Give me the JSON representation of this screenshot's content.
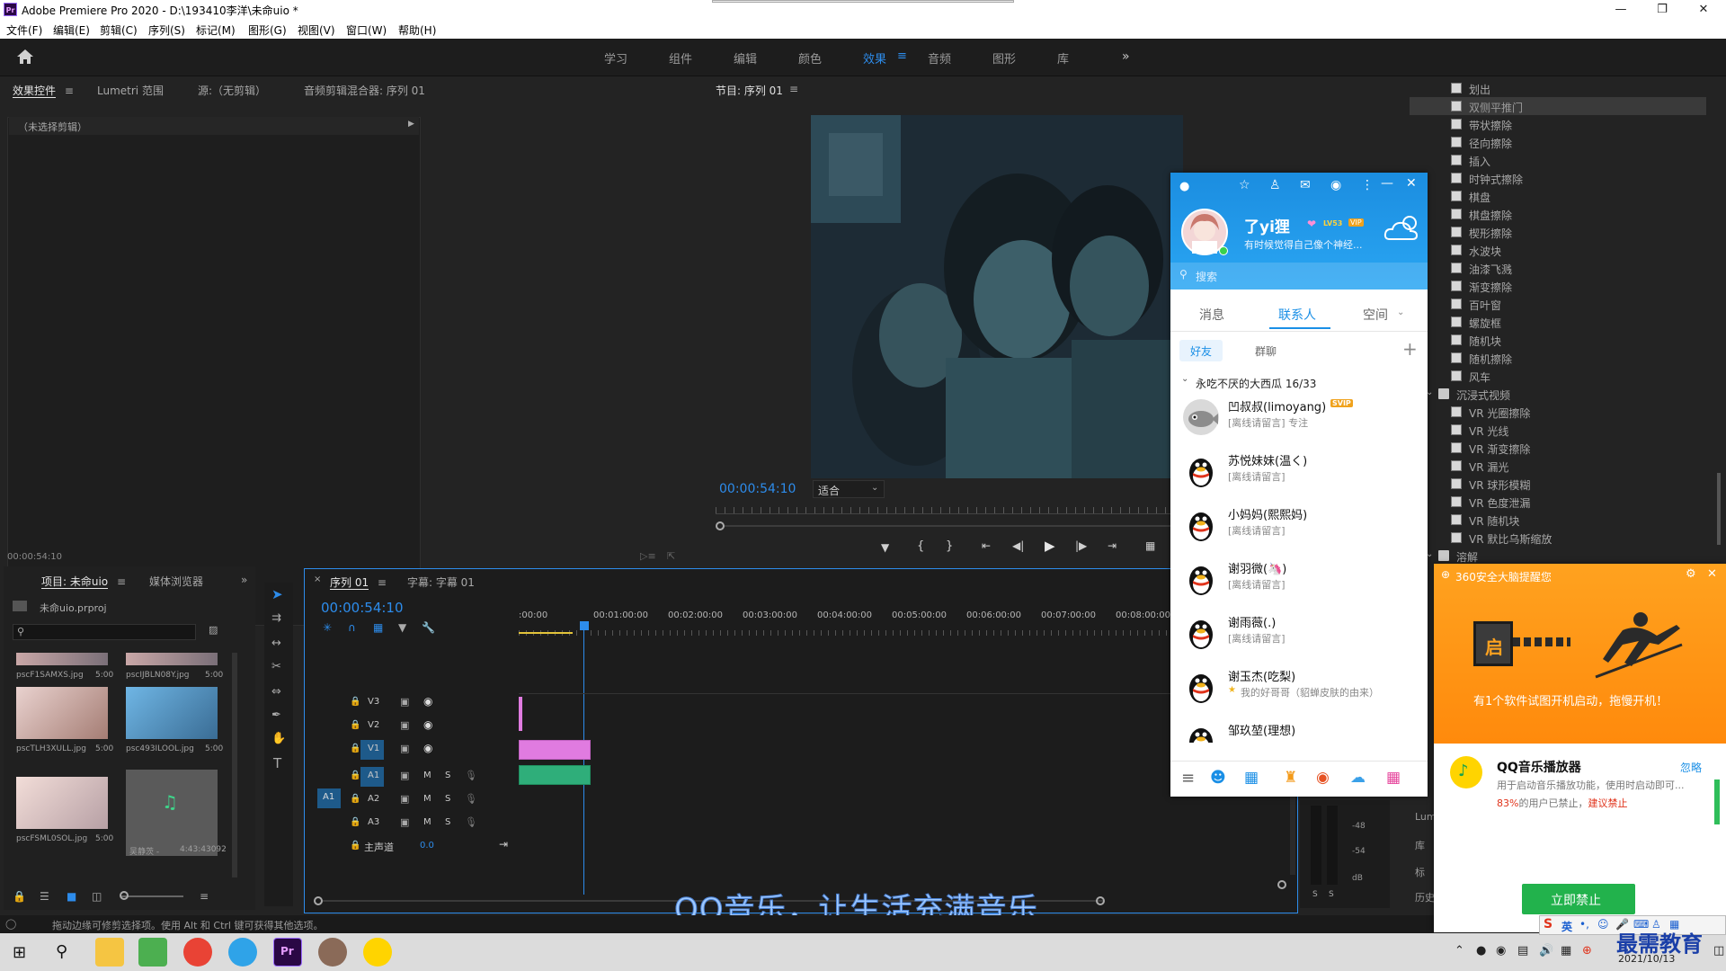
{
  "window": {
    "title": "Adobe Premiere Pro 2020 - D:\\193410李洋\\未命uio *",
    "app_icon": "Pr"
  },
  "menu": [
    "文件(F)",
    "编辑(E)",
    "剪辑(C)",
    "序列(S)",
    "标记(M)",
    "图形(G)",
    "视图(V)",
    "窗口(W)",
    "帮助(H)"
  ],
  "workspaces": [
    "学习",
    "组件",
    "编辑",
    "颜色",
    "效果",
    "音频",
    "图形",
    "库"
  ],
  "workspace_active": "效果",
  "effect_controls": {
    "tabs": [
      "效果控件",
      "Lumetri 范围",
      "源:（无剪辑）",
      "音频剪辑混合器: 序列 01"
    ],
    "empty_label": "（未选择剪辑）",
    "timecode": "00:00:54:10"
  },
  "program_monitor": {
    "title": "节目: 序列 01",
    "timecode": "00:00:54:10",
    "fit": "适合"
  },
  "effects_list": {
    "items": [
      "划出",
      "双侧平推门",
      "带状擦除",
      "径向擦除",
      "插入",
      "时钟式擦除",
      "棋盘",
      "棋盘擦除",
      "楔形擦除",
      "水波块",
      "油漆飞溅",
      "渐变擦除",
      "百叶窗",
      "螺旋框",
      "随机块",
      "随机擦除",
      "风车"
    ],
    "folder_1": "沉浸式视频",
    "vr_items": [
      "VR 光圈擦除",
      "VR 光线",
      "VR 渐变擦除",
      "VR 漏光",
      "VR 球形模糊",
      "VR 色度泄漏",
      "VR 随机块",
      "VR 默比乌斯缩放"
    ],
    "folder_2": "溶解",
    "selected": "双侧平推门"
  },
  "project": {
    "tabs": [
      "项目: 未命uio",
      "媒体浏览器"
    ],
    "file": "未命uio.prproj",
    "thumbs": [
      {
        "name": "pscF1SAMXS.jpg",
        "dur": "5:00"
      },
      {
        "name": "pscIJBLN08Y.jpg",
        "dur": "5:00"
      },
      {
        "name": "pscTLH3XULL.jpg",
        "dur": "5:00"
      },
      {
        "name": "psc493ILOOL.jpg",
        "dur": "5:00"
      },
      {
        "name": "pscFSML0SOL.jpg",
        "dur": "5:00"
      },
      {
        "name": "吴静茨 -",
        "dur": "4:43:43092"
      }
    ]
  },
  "timeline": {
    "tabs": [
      "序列 01",
      "字幕: 字幕 01"
    ],
    "timecode": "00:00:54:10",
    "ruler": [
      ":00:00",
      "00:01:00:00",
      "00:02:00:00",
      "00:03:00:00",
      "00:04:00:00",
      "00:05:00:00",
      "00:06:00:00",
      "00:07:00:00",
      "00:08:00:00"
    ],
    "video_tracks": [
      "V3",
      "V2",
      "V1"
    ],
    "audio_tracks": [
      "A1",
      "A2",
      "A3"
    ],
    "master_label": "主声道",
    "master_value": "0.0",
    "a1_source": "A1",
    "track_m": "M",
    "track_s": "S"
  },
  "subtitle": "QQ音乐，让生活充满音乐",
  "status_bar": "拖动边缘可修剪选择项。使用 Alt 和 Ctrl 键可获得其他选项。",
  "qq": {
    "nickname": "了yi狸",
    "level": "LV53",
    "vip": "VIP",
    "signature": "有时候觉得自己像个神经...",
    "search_placeholder": "搜索",
    "tabs": [
      "消息",
      "联系人",
      "空间"
    ],
    "active_tab": "联系人",
    "subtabs": [
      "好友",
      "群聊"
    ],
    "group": "永吃不厌的大西瓜 16/33",
    "contacts": [
      {
        "name": "凹叔叔(limoyang)",
        "badge": "SVIP",
        "status": "[离线请留言] 专注"
      },
      {
        "name": "苏悦妹妹(温く)",
        "status": "[离线请留言]"
      },
      {
        "name": "小妈妈(熙熙妈)",
        "status": "[离线请留言]"
      },
      {
        "name": "谢羽微(🦄)",
        "status": "[离线请留言]"
      },
      {
        "name": "谢雨薇(.)",
        "status": "[离线请留言]"
      },
      {
        "name": "谢玉杰(吃梨)",
        "status": "我的好哥哥（貂蝉皮肤的由来）"
      },
      {
        "name": "邹玖堃(理想)",
        "status": ""
      }
    ]
  },
  "p360": {
    "header": "360安全大脑提醒您",
    "message": "有1个软件试图开机启动，拖慢开机！",
    "app": "QQ音乐播放器",
    "ignore": "忽略",
    "desc": "用于启动音乐播放功能，使用时启动即可...",
    "stat_pct": "83%",
    "stat_rest": "的用户已禁止，",
    "advice": "建议禁止",
    "button": "立即禁止",
    "door_char": "启"
  },
  "right_side_labels": [
    "Lum",
    "库",
    "标",
    "历史"
  ],
  "meter_labels": [
    "-48",
    "-54",
    "dB"
  ],
  "taskbar": {
    "clock_date": "2021/10/13",
    "ime": "英",
    "watermark": "最需教育"
  }
}
